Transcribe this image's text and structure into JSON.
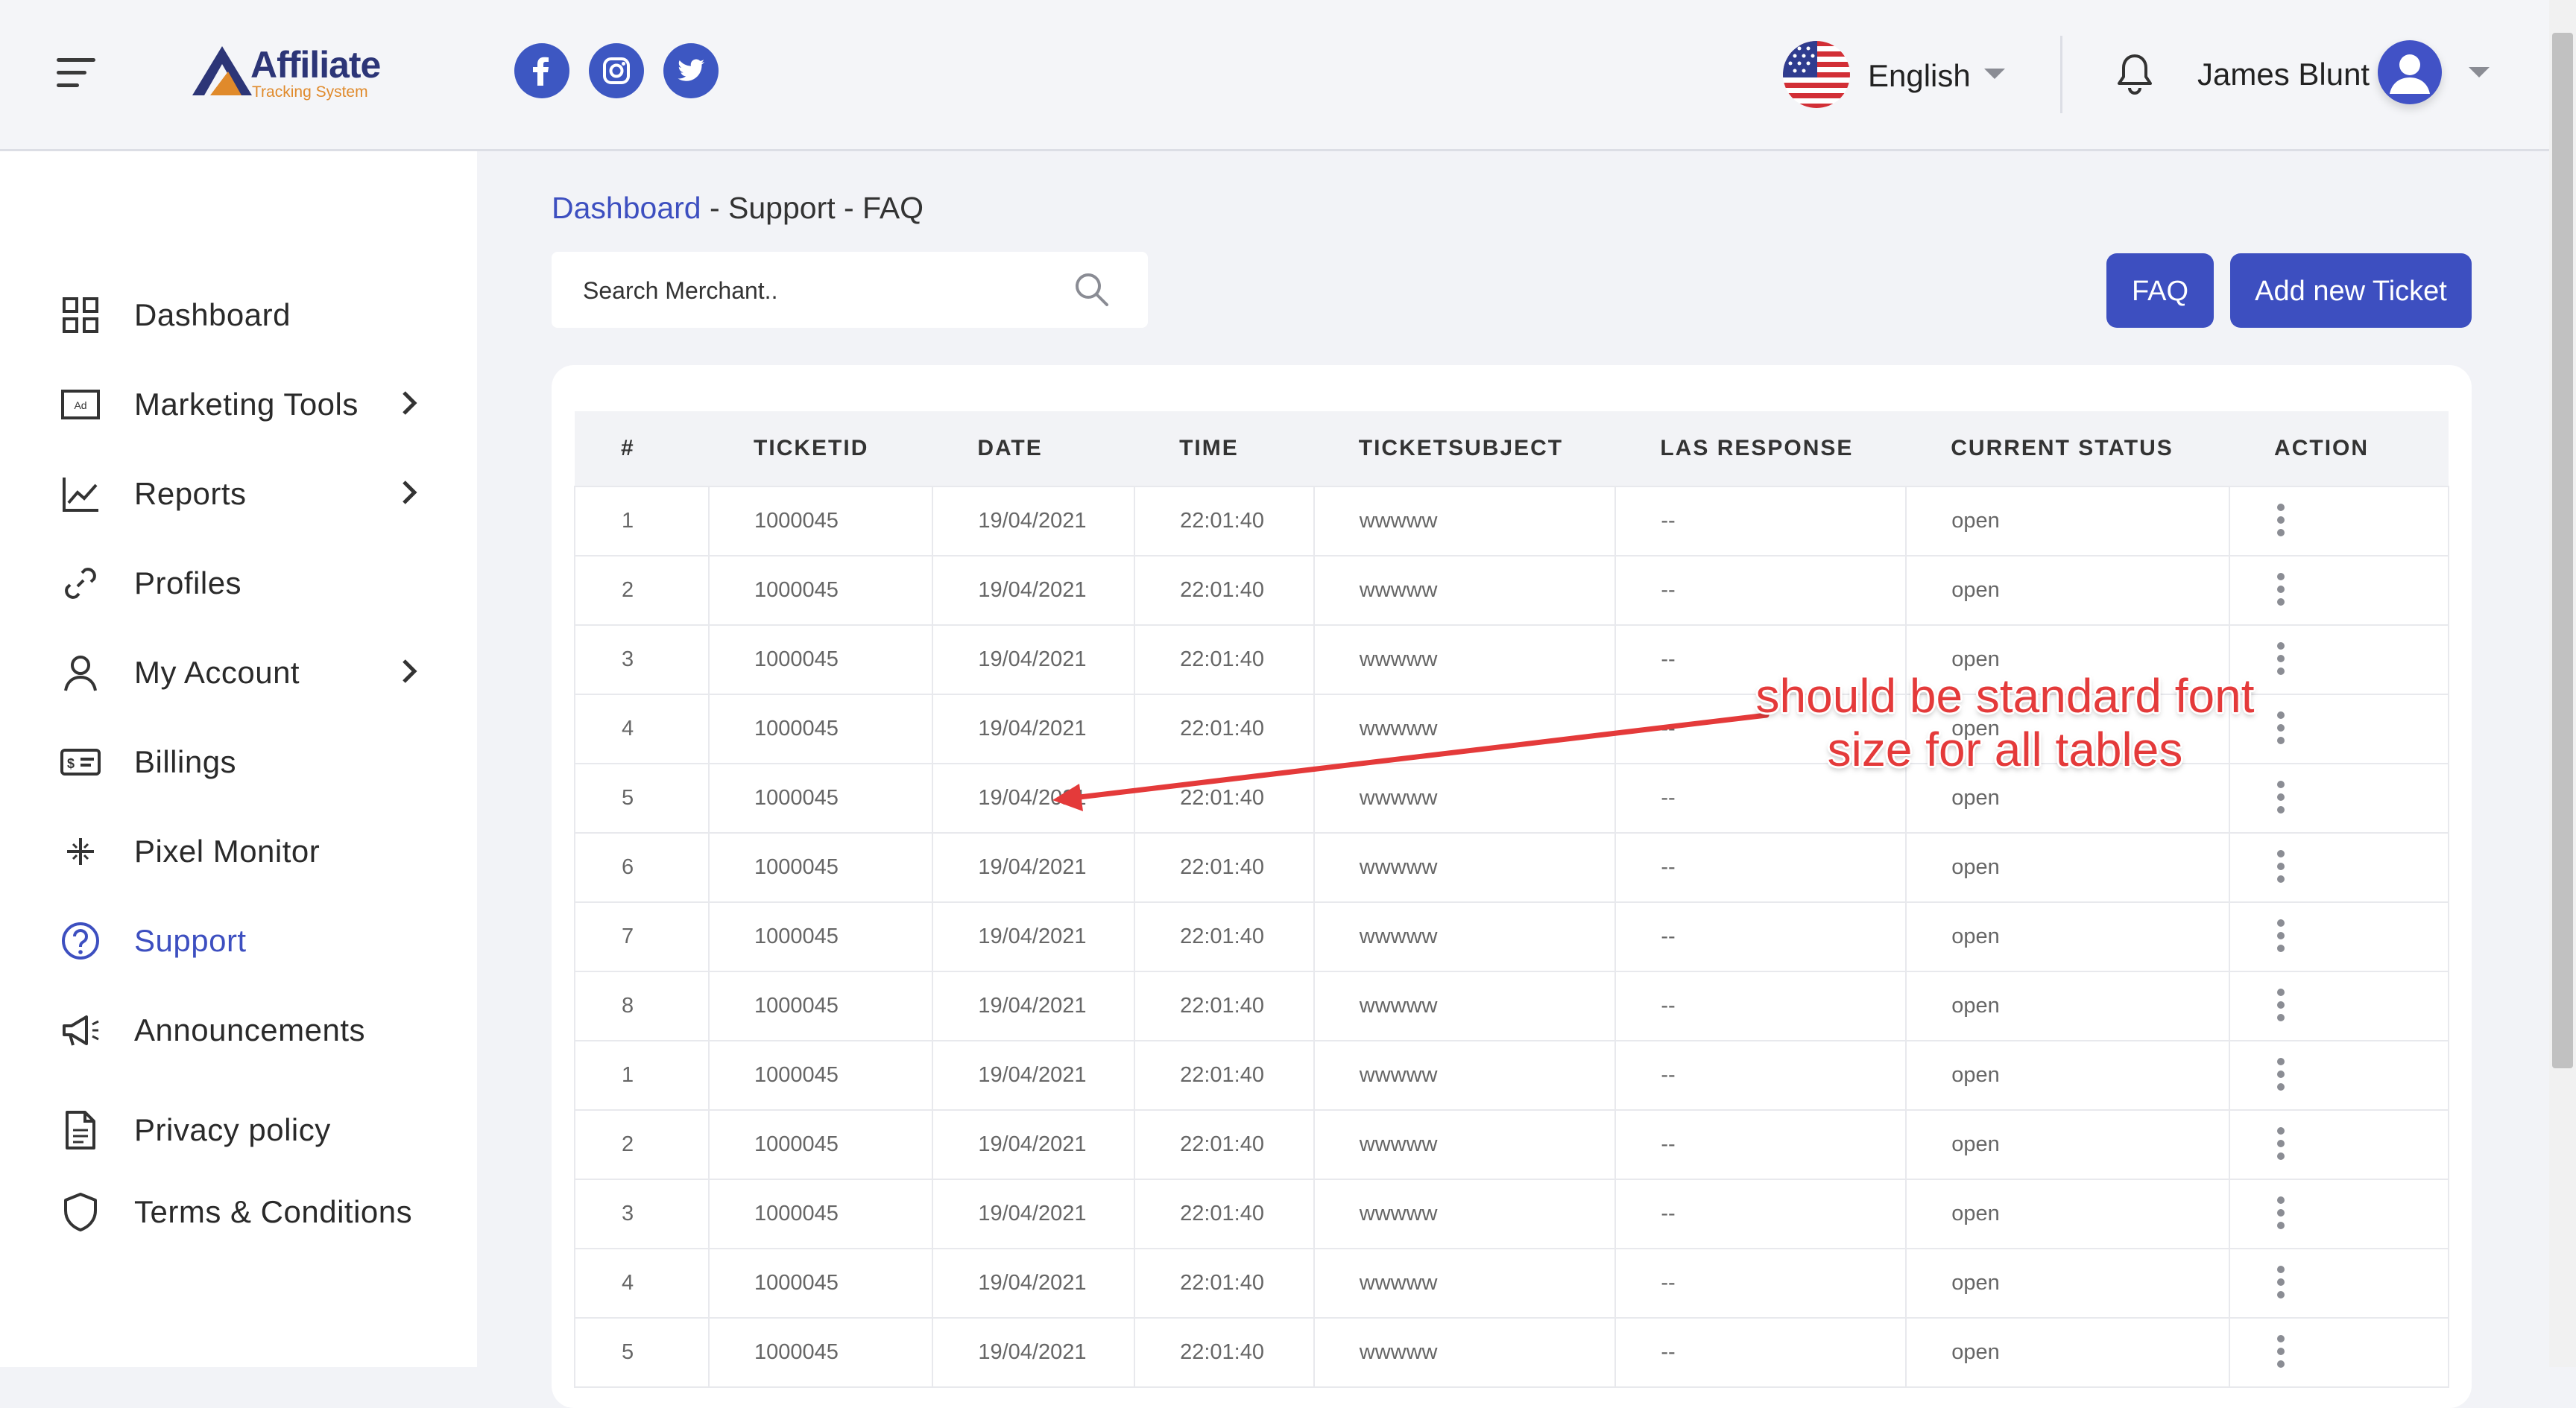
{
  "header": {
    "logo_title": "Affiliate",
    "logo_subtitle": "Tracking System",
    "social": [
      "facebook-icon",
      "instagram-icon",
      "twitter-icon"
    ],
    "language": "English",
    "username": "James Blunt"
  },
  "sidebar": {
    "items": [
      {
        "label": "Dashboard",
        "icon": "dashboard-grid-icon",
        "has_submenu": false
      },
      {
        "label": "Marketing Tools",
        "icon": "ad-icon",
        "has_submenu": true
      },
      {
        "label": "Reports",
        "icon": "chart-line-icon",
        "has_submenu": true
      },
      {
        "label": "Profiles",
        "icon": "link-icon",
        "has_submenu": false
      },
      {
        "label": "My Account",
        "icon": "user-icon",
        "has_submenu": true
      },
      {
        "label": "Billings",
        "icon": "billing-icon",
        "has_submenu": false
      },
      {
        "label": "Pixel Monitor",
        "icon": "pixel-sparkle-icon",
        "has_submenu": false
      },
      {
        "label": "Support",
        "icon": "help-circle-icon",
        "has_submenu": false,
        "active": true
      },
      {
        "label": "Announcements",
        "icon": "megaphone-icon",
        "has_submenu": false
      },
      {
        "label": "Privacy policy",
        "icon": "document-icon",
        "has_submenu": false
      },
      {
        "label": "Terms & Conditions",
        "icon": "shield-icon",
        "has_submenu": false
      }
    ]
  },
  "breadcrumb": {
    "link": "Dashboard",
    "sep": " - ",
    "rest": "Support - FAQ"
  },
  "search": {
    "placeholder": "Search Merchant.."
  },
  "buttons": {
    "faq": "FAQ",
    "add_ticket": "Add new Ticket"
  },
  "table": {
    "headers": [
      "#",
      "TICKETID",
      "DATE",
      "TIME",
      "TICKETSUBJECT",
      "LAS RESPONSE",
      "CURRENT STATUS",
      "ACTION"
    ],
    "rows": [
      [
        "1",
        "1000045",
        "19/04/2021",
        "22:01:40",
        "wwwww",
        "--",
        "open"
      ],
      [
        "2",
        "1000045",
        "19/04/2021",
        "22:01:40",
        "wwwww",
        "--",
        "open"
      ],
      [
        "3",
        "1000045",
        "19/04/2021",
        "22:01:40",
        "wwwww",
        "--",
        "open"
      ],
      [
        "4",
        "1000045",
        "19/04/2021",
        "22:01:40",
        "wwwww",
        "--",
        "open"
      ],
      [
        "5",
        "1000045",
        "19/04/2021",
        "22:01:40",
        "wwwww",
        "--",
        "open"
      ],
      [
        "6",
        "1000045",
        "19/04/2021",
        "22:01:40",
        "wwwww",
        "--",
        "open"
      ],
      [
        "7",
        "1000045",
        "19/04/2021",
        "22:01:40",
        "wwwww",
        "--",
        "open"
      ],
      [
        "8",
        "1000045",
        "19/04/2021",
        "22:01:40",
        "wwwww",
        "--",
        "open"
      ],
      [
        "1",
        "1000045",
        "19/04/2021",
        "22:01:40",
        "wwwww",
        "--",
        "open"
      ],
      [
        "2",
        "1000045",
        "19/04/2021",
        "22:01:40",
        "wwwww",
        "--",
        "open"
      ],
      [
        "3",
        "1000045",
        "19/04/2021",
        "22:01:40",
        "wwwww",
        "--",
        "open"
      ],
      [
        "4",
        "1000045",
        "19/04/2021",
        "22:01:40",
        "wwwww",
        "--",
        "open"
      ],
      [
        "5",
        "1000045",
        "19/04/2021",
        "22:01:40",
        "wwwww",
        "--",
        "open"
      ]
    ]
  },
  "annotation": {
    "line1": "should be standard font",
    "line2": "size for all tables",
    "color": "#e43a3a"
  },
  "colors": {
    "accent": "#3d4fc0",
    "logo_navy": "#2c3577",
    "logo_orange": "#e08a2b"
  }
}
